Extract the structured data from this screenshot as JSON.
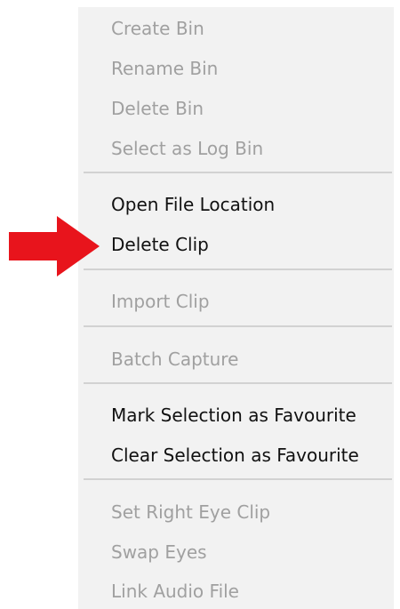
{
  "menu": {
    "groups": [
      {
        "items": [
          {
            "label": "Create Bin",
            "enabled": false
          },
          {
            "label": "Rename Bin",
            "enabled": false
          },
          {
            "label": "Delete Bin",
            "enabled": false
          },
          {
            "label": "Select as Log Bin",
            "enabled": false
          }
        ]
      },
      {
        "items": [
          {
            "label": "Open File Location",
            "enabled": true
          },
          {
            "label": "Delete Clip",
            "enabled": true
          }
        ]
      },
      {
        "items": [
          {
            "label": "Import Clip",
            "enabled": false
          }
        ]
      },
      {
        "items": [
          {
            "label": "Batch Capture",
            "enabled": false
          }
        ]
      },
      {
        "items": [
          {
            "label": "Mark Selection as Favourite",
            "enabled": true
          },
          {
            "label": "Clear Selection as Favourite",
            "enabled": true
          }
        ]
      },
      {
        "items": [
          {
            "label": "Set Right Eye Clip",
            "enabled": false
          },
          {
            "label": "Swap Eyes",
            "enabled": false
          },
          {
            "label": "Link Audio File",
            "enabled": false
          }
        ]
      }
    ]
  },
  "annotation": {
    "icon": "red-arrow-icon",
    "color": "#e8141c",
    "points_to": "Delete Clip"
  }
}
